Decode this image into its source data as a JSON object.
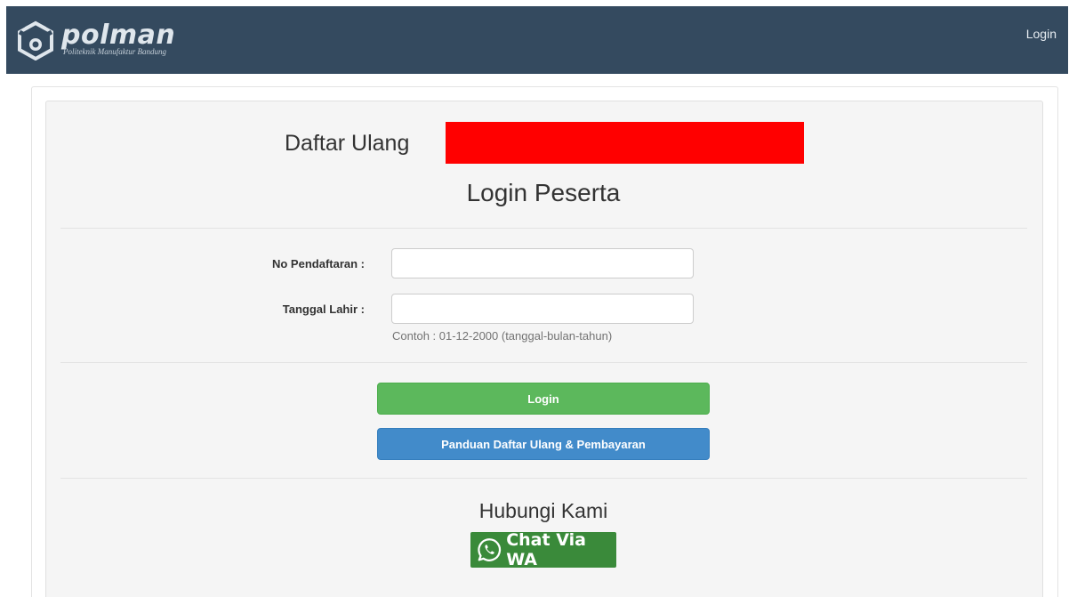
{
  "navbar": {
    "brand_name": "polman",
    "brand_subtitle": "Politeknik Manufaktur Bandung",
    "login_link": "Login",
    "bg_color": "#344a5f"
  },
  "header": {
    "title_prefix": "Daftar Ulang",
    "subtitle": "Login Peserta",
    "redaction_color": "#ff0000"
  },
  "form": {
    "registration_label": "No Pendaftaran :",
    "registration_value": "",
    "birthdate_label": "Tanggal Lahir :",
    "birthdate_value": "",
    "birthdate_help": "Contoh : 01-12-2000 (tanggal-bulan-tahun)"
  },
  "actions": {
    "login_label": "Login",
    "login_color": "#5cb85c",
    "guide_label": "Panduan Daftar Ulang & Pembayaran",
    "guide_color": "#428bca"
  },
  "contact": {
    "title": "Hubungi Kami",
    "wa_label": "Chat Via WA",
    "wa_icon": "whatsapp-icon",
    "wa_color": "#3a8a3a"
  }
}
